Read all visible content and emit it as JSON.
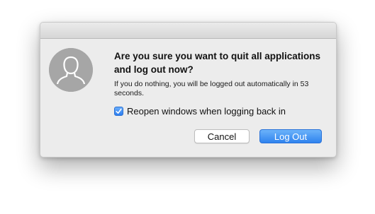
{
  "dialog": {
    "heading": "Are you sure you want to quit all applications and log out now?",
    "message": "If you do nothing, you will be logged out automatically in 53 seconds.",
    "reopen_checkbox": {
      "label": "Reopen windows when logging back in",
      "checked": true
    },
    "buttons": {
      "cancel": "Cancel",
      "log_out": "Log Out"
    },
    "avatar_icon": "user-silhouette-icon",
    "accent_color": "#3d8ef5"
  }
}
